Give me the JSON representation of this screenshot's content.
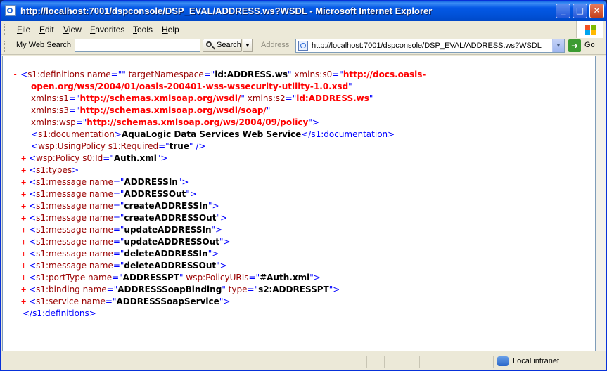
{
  "window": {
    "title": "http://localhost:7001/dspconsole/DSP_EVAL/ADDRESS.ws?WSDL - Microsoft Internet Explorer"
  },
  "titlebar": {
    "minimize_icon": "minimize-icon",
    "maximize_icon": "maximize-icon",
    "close_icon": "close-icon"
  },
  "menu": [
    "File",
    "Edit",
    "View",
    "Favorites",
    "Tools",
    "Help"
  ],
  "toolbar": {
    "my_web_search_label": "My Web Search",
    "search_value": "",
    "search_button_label": "Search",
    "address_label": "Address",
    "address_value": "http://localhost:7001/dspconsole/DSP_EVAL/ADDRESS.ws?WSDL",
    "go_label": "Go"
  },
  "xml": {
    "minus": "-",
    "plus": "+",
    "open": "<",
    "close": ">",
    "selfclose": "/>",
    "eq": "=",
    "q": "\"",
    "line0": {
      "tag": "s1:definitions",
      "name_attr": "name",
      "name_val": "",
      "tns_attr": "targetNamespace",
      "tns_val": "ld:ADDRESS.ws",
      "xs0_attr": "xmlns:s0",
      "xs0_val_a": "http://docs.oasis-",
      "xs0_val_b": "open.org/wss/2004/01/oasis-200401-wss-wssecurity-utility-1.0.xsd"
    },
    "xs1_attr": "xmlns:s1",
    "xs1_val": "http://schemas.xmlsoap.org/wsdl/",
    "xs2_attr": "xmlns:s2",
    "xs2_val": "ld:ADDRESS.ws",
    "xs3_attr": "xmlns:s3",
    "xs3_val": "http://schemas.xmlsoap.org/wsdl/soap/",
    "xwsp_attr": "xmlns:wsp",
    "xwsp_val": "http://schemas.xmlsoap.org/ws/2004/09/policy",
    "doc_open": "s1:documentation",
    "doc_text": "AquaLogic Data Services Web Service",
    "doc_close": "</s1:documentation>",
    "using_tag": "wsp:UsingPolicy",
    "using_attr": "s1:Required",
    "using_val": "true",
    "policy_tag": "wsp:Policy",
    "policy_attr": "s0:Id",
    "policy_val": "Auth.xml",
    "types_tag": "s1:types",
    "msg_tag": "s1:message",
    "msg_attr": "name",
    "messages": [
      "ADDRESSIn",
      "ADDRESSOut",
      "createADDRESSIn",
      "createADDRESSOut",
      "updateADDRESSIn",
      "updateADDRESSOut",
      "deleteADDRESSIn",
      "deleteADDRESSOut"
    ],
    "port_tag": "s1:portType",
    "port_attr": "name",
    "port_val": "ADDRESSPT",
    "port_attr2": "wsp:PolicyURIs",
    "port_val2": "#Auth.xml",
    "bind_tag": "s1:binding",
    "bind_attr": "name",
    "bind_val": "ADDRESSSoapBinding",
    "bind_attr2": "type",
    "bind_val2": "s2:ADDRESSPT",
    "svc_tag": "s1:service",
    "svc_attr": "name",
    "svc_val": "ADDRESSSoapService",
    "end_tag": "</s1:definitions>"
  },
  "status": {
    "zone": "Local intranet",
    "zone_icon": "intranet-icon"
  },
  "colors": {
    "titlebar": "#0054e3",
    "tag": "#990000",
    "ns_value": "#ff0000",
    "plus": "#ff0000"
  }
}
